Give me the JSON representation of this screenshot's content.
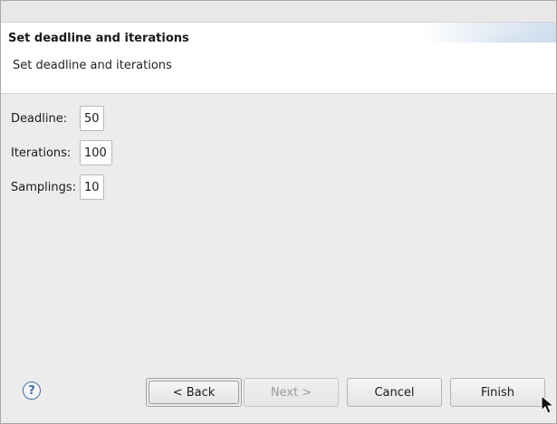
{
  "banner": {
    "title": "Set deadline and iterations",
    "description": "Set deadline and iterations"
  },
  "form": {
    "deadline": {
      "label": "Deadline:",
      "value": "50"
    },
    "iterations": {
      "label": "Iterations:",
      "value": "100"
    },
    "samplings": {
      "label": "Samplings:",
      "value": "10"
    }
  },
  "footer": {
    "help_glyph": "?",
    "back_label": "< Back",
    "next_label": "Next >",
    "cancel_label": "Cancel",
    "finish_label": "Finish"
  },
  "icons": {
    "help": "help-icon",
    "cursor": "mouse-pointer-icon"
  },
  "colors": {
    "background": "#ececec",
    "banner_background": "#ffffff",
    "help_accent": "#4a6e9e",
    "disabled_text": "#9a9a9a"
  }
}
